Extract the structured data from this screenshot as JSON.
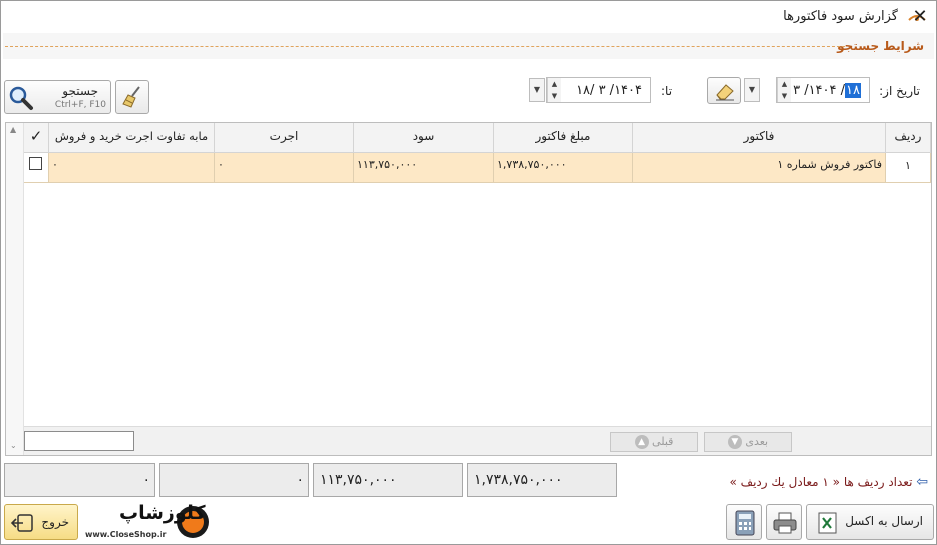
{
  "window": {
    "title": "گزارش سود فاکتورها",
    "close_glyph": "✕"
  },
  "search_section": {
    "title": "شرایط جستجو",
    "from_label": "تاریخ از:",
    "from_date": {
      "day": "۱۸",
      "rest": "/ ۱۴۰۴/ ۳"
    },
    "to_label": "تا:",
    "to_date": "۱۴۰۴/ ۳ /۱۸",
    "search_button_label": "جستجو",
    "search_button_hint": "Ctrl+F, F10"
  },
  "grid": {
    "columns": [
      "ردیف",
      "فاکتور",
      "مبلغ فاکتور",
      "سود",
      "اجرت",
      "مابه تفاوت اجرت خرید و فروش"
    ],
    "check_header": "✓",
    "rows": [
      {
        "index": "۱",
        "invoice": "فاکتور فروش شماره ۱",
        "amount": "۱,۷۳۸,۷۵۰,۰۰۰",
        "profit": "۱۱۳,۷۵۰,۰۰۰",
        "wage": "۰",
        "wage_diff": "۰"
      }
    ],
    "pager": {
      "next": "بعدی",
      "prev": "قبلی"
    }
  },
  "totals": {
    "amount": "۱,۷۳۸,۷۵۰,۰۰۰",
    "profit": "۱۱۳,۷۵۰,۰۰۰",
    "wage": "۰",
    "wage_diff": "۰"
  },
  "footer": {
    "row_count_text": "تعداد ردیف ها « ۱ معادل یك ردیف »",
    "export_excel_label": "ارسال به اکسل",
    "exit_label": "خروج",
    "logo_text": "کلوزشاپ",
    "logo_url_text": "www.CloseShop.ir"
  },
  "colors": {
    "section_title": "#b85a1a",
    "row_highlight": "#fde8c6",
    "date_highlight": "#1f6fd6",
    "row_count": "#7a1a1a"
  }
}
